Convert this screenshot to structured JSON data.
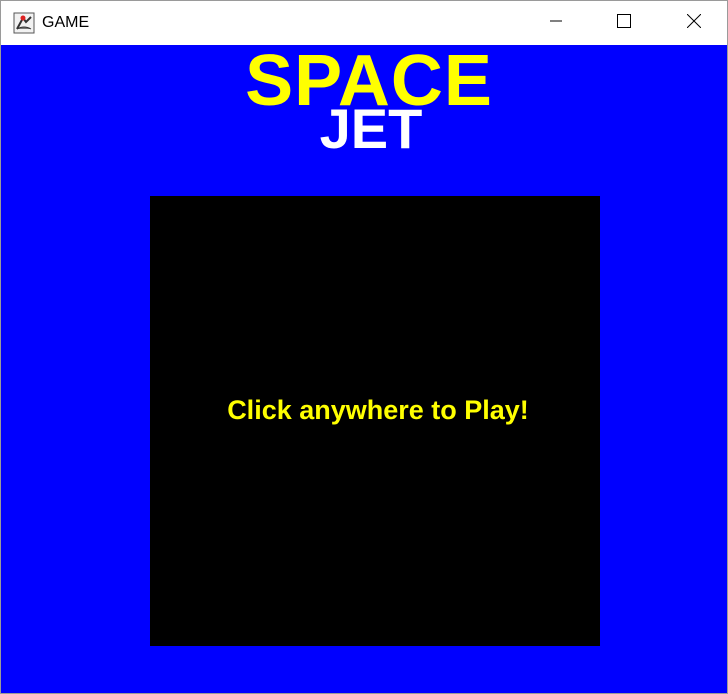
{
  "window": {
    "title": "GAME",
    "icon": "java-app-icon",
    "controls": [
      "minimize-icon",
      "maximize-icon",
      "close-icon"
    ]
  },
  "game": {
    "title_line1": "SPACE",
    "title_line2": "JET",
    "prompt": "Click anywhere to Play!"
  },
  "colors": {
    "background": "#0000ff",
    "title_line1": "#ffff00",
    "title_line2": "#ffffff",
    "panel": "#000000",
    "prompt": "#ffff00"
  }
}
